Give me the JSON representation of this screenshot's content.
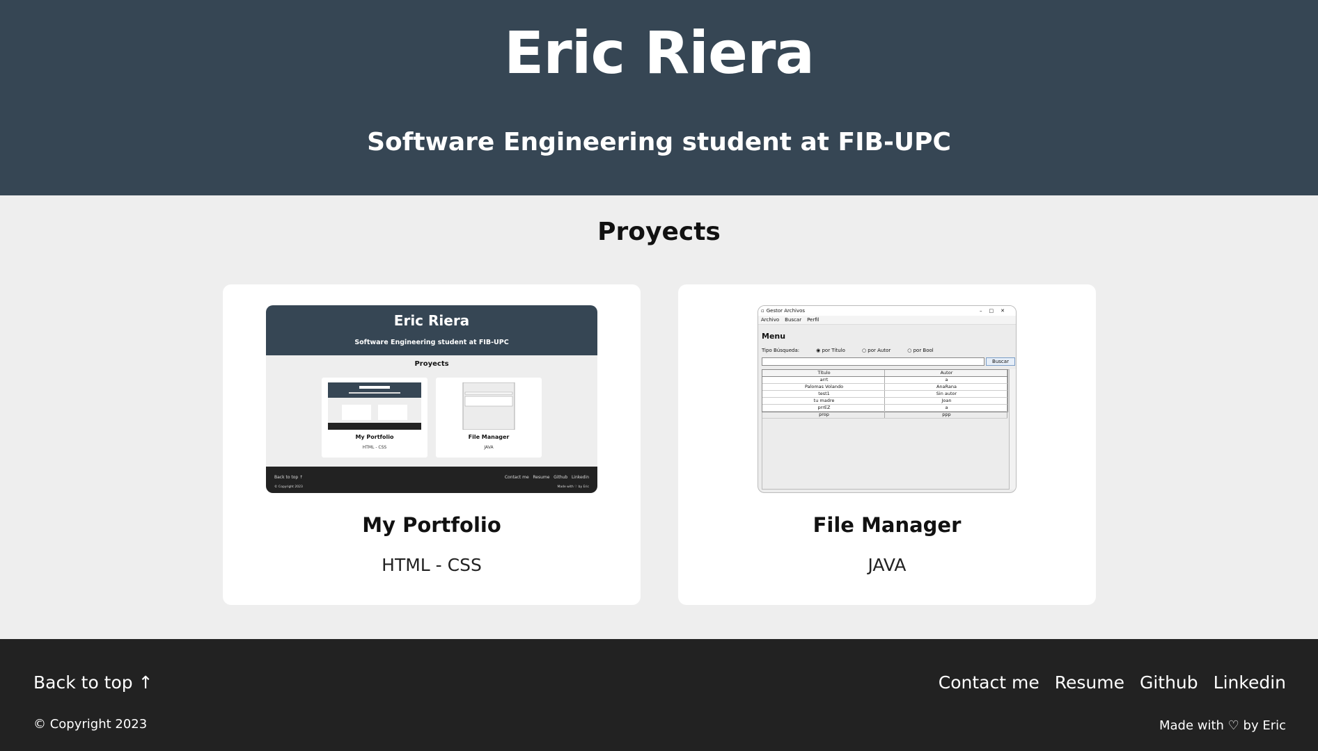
{
  "header": {
    "name": "Eric Riera",
    "subtitle": "Software Engineering student at FIB-UPC"
  },
  "projects": {
    "heading": "Proyects",
    "cards": [
      {
        "title": "My Portfolio",
        "tech": "HTML - CSS"
      },
      {
        "title": "File Manager",
        "tech": "JAVA"
      }
    ],
    "portfolio_thumb": {
      "name": "Eric Riera",
      "subtitle": "Software Engineering student at FIB-UPC",
      "heading": "Proyects",
      "card1_title": "My Portfolio",
      "card1_tech": "HTML - CSS",
      "card2_title": "File Manager",
      "card2_tech": "JAVA",
      "back_to_top": "Back to top ↑",
      "links": "Contact me   Resume   Github   Linkedin",
      "copyright": "© Copyright 2023",
      "made_with": "Made with ♡ by Eric"
    },
    "java_thumb": {
      "window_title": "Gestor Archivos",
      "menus": [
        "Archivo",
        "Buscar",
        "Perfil"
      ],
      "menu_title": "Menu",
      "search_type_label": "Tipo Búsqueda:",
      "options": [
        "por Título",
        "por Autor",
        "por Bool"
      ],
      "search_button": "Buscar",
      "columns": [
        "Título",
        "Autor"
      ],
      "rows": [
        [
          "arrt",
          "a"
        ],
        [
          "Palomas Volando",
          "AnaRana"
        ],
        [
          "test1",
          "Sin autor"
        ],
        [
          "tu madre",
          "Joan"
        ],
        [
          "prrEZ",
          "a"
        ],
        [
          "prop",
          "ppp"
        ]
      ]
    }
  },
  "footer": {
    "back_to_top": "Back to top ↑",
    "copyright": "© Copyright 2023",
    "links": [
      "Contact me",
      "Resume",
      "Github",
      "Linkedin"
    ],
    "made_with": "Made with ♡ by Eric"
  }
}
